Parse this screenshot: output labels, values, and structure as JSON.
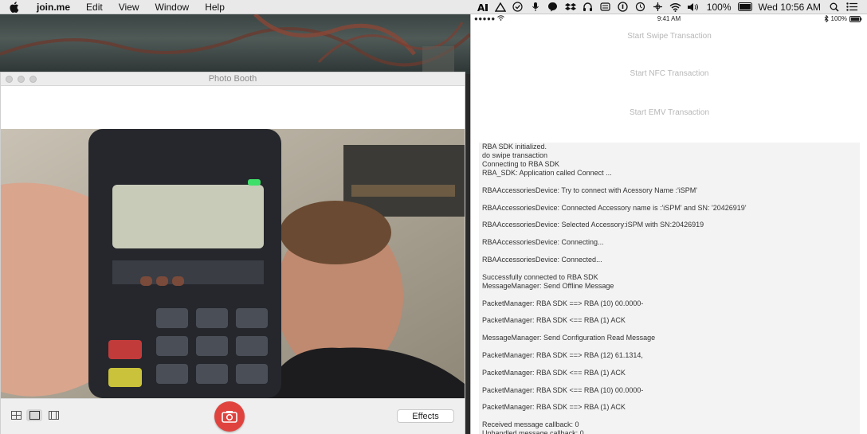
{
  "menubar": {
    "app_name": "join.me",
    "menus": [
      "Edit",
      "View",
      "Window",
      "Help"
    ],
    "battery": "100%",
    "clock": "Wed 10:56 AM"
  },
  "photobooth": {
    "window_title": "Photo Booth",
    "effects_label": "Effects"
  },
  "ios": {
    "carrier_signal": "●●●●●",
    "time": "9:41 AM",
    "battery": "100%",
    "buttons": [
      "Start Swipe Transaction",
      "Start NFC Transaction",
      "Start EMV Transaction"
    ],
    "log": [
      [
        "RBA SDK initialized.",
        "do swipe transaction",
        "Connecting to RBA SDK",
        "RBA_SDK: Application called Connect ..."
      ],
      [
        "RBAAccessoriesDevice: Try to connect with Acessory Name :'iSPM'"
      ],
      [
        "RBAAccessoriesDevice: Connected Accessory name is       :'iSPM' and SN: '20426919'"
      ],
      [
        "RBAAccessoriesDevice: Selected Accessory:iSPM with SN:20426919"
      ],
      [
        "RBAAccessoriesDevice: Connecting..."
      ],
      [
        "RBAAccessoriesDevice: Connected..."
      ],
      [
        "Successfully connected to RBA SDK",
        "MessageManager: Send Offline Message"
      ],
      [
        "PacketManager: RBA SDK ==> RBA (10) 00.0000-"
      ],
      [
        "PacketManager: RBA SDK <== RBA (1) ACK"
      ],
      [
        "MessageManager: Send Configuration Read Message"
      ],
      [
        "PacketManager: RBA SDK ==> RBA (12) 61.1314,"
      ],
      [
        "PacketManager: RBA SDK <== RBA (1) ACK"
      ],
      [
        "PacketManager: RBA SDK <== RBA (10) 00.0000-"
      ],
      [
        "PacketManager: RBA SDK ==> RBA (1) ACK"
      ],
      [
        "Received message callback: 0",
        "Unhandled message callback: 0"
      ]
    ]
  }
}
